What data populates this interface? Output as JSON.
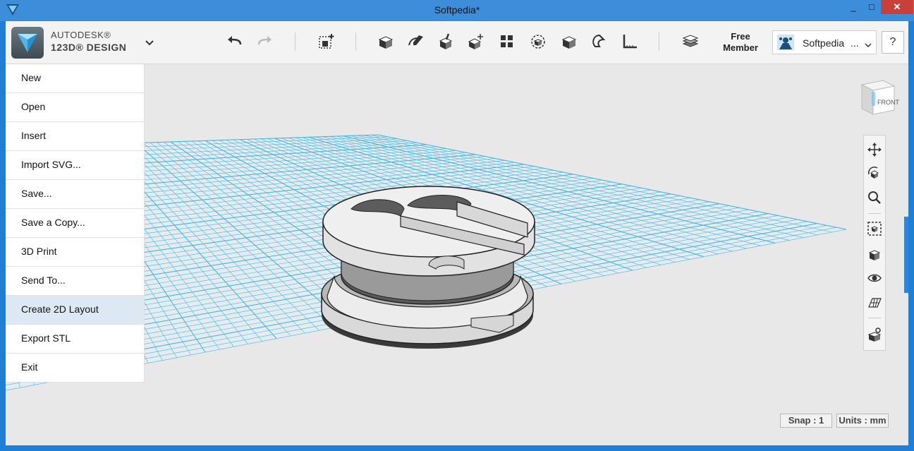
{
  "window": {
    "title": "Softpedia*",
    "minimize": "_",
    "maximize": "□",
    "close": "✕"
  },
  "brand": {
    "line1": "AUTODESK®",
    "line2": "123D® DESIGN"
  },
  "toolbar": {
    "icons": [
      "undo-icon",
      "redo-icon",
      "primitives-icon",
      "sketch-icon",
      "construct-icon",
      "modify-icon",
      "pattern-icon",
      "group-icon",
      "combine-icon",
      "snap-icon",
      "measure-icon",
      "material-icon"
    ]
  },
  "account": {
    "member_line1": "Free",
    "member_line2": "Member",
    "name": "Softpedia",
    "dots": "...",
    "help": "?"
  },
  "menu": {
    "items": [
      "New",
      "Open",
      "Insert",
      "Import SVG...",
      "Save...",
      "Save a Copy...",
      "3D Print",
      "Send To...",
      "Create 2D Layout",
      "Export STL",
      "Exit"
    ],
    "active_index": 8
  },
  "viewcube": {
    "face_label": "FRONT"
  },
  "status": {
    "snap": "Snap : 1",
    "units": "Units : mm"
  },
  "colors": {
    "accent": "#2f86d6",
    "grid": "#4ab3de",
    "title_bar": "#3c8edb"
  }
}
